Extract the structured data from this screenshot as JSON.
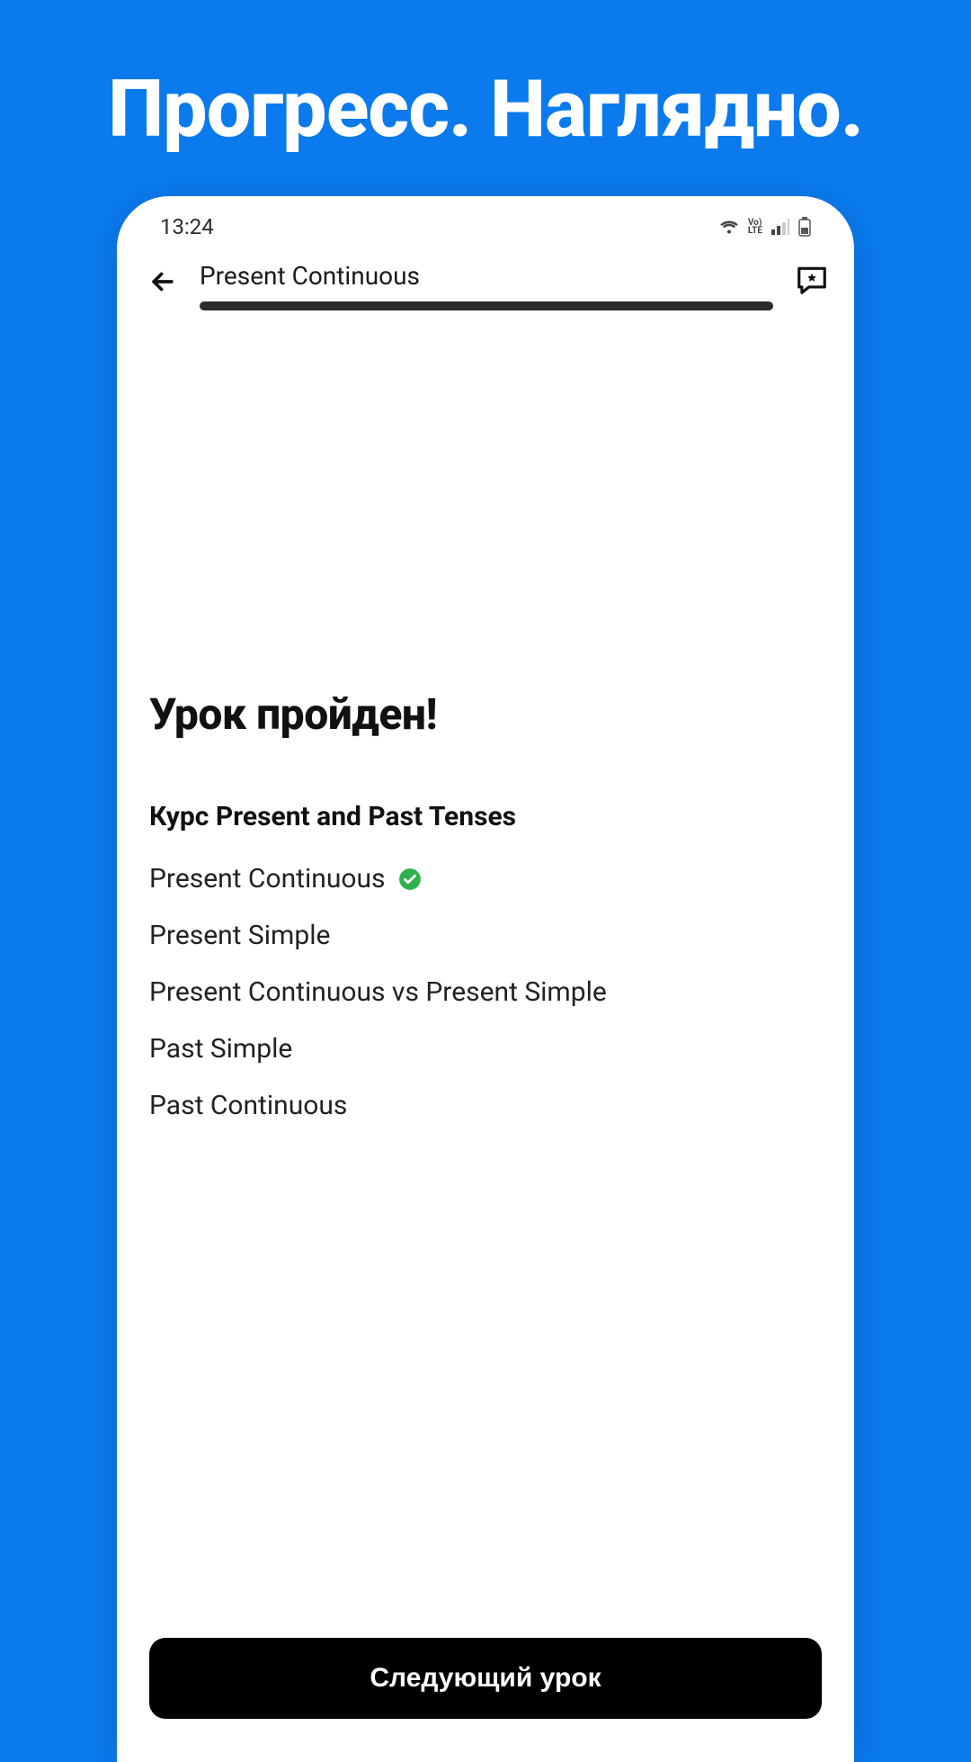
{
  "promo": {
    "title": "Прогресс. Наглядно."
  },
  "status": {
    "time": "13:24"
  },
  "header": {
    "title": "Present Continuous"
  },
  "main": {
    "lesson_done": "Урок пройден!",
    "course_title": "Курс Present and Past Tenses",
    "lessons": [
      {
        "label": "Present Continuous",
        "done": true
      },
      {
        "label": "Present Simple",
        "done": false
      },
      {
        "label": "Present Continuous vs Present Simple",
        "done": false
      },
      {
        "label": "Past Simple",
        "done": false
      },
      {
        "label": "Past Continuous",
        "done": false
      }
    ]
  },
  "footer": {
    "next_button": "Следующий урок"
  }
}
